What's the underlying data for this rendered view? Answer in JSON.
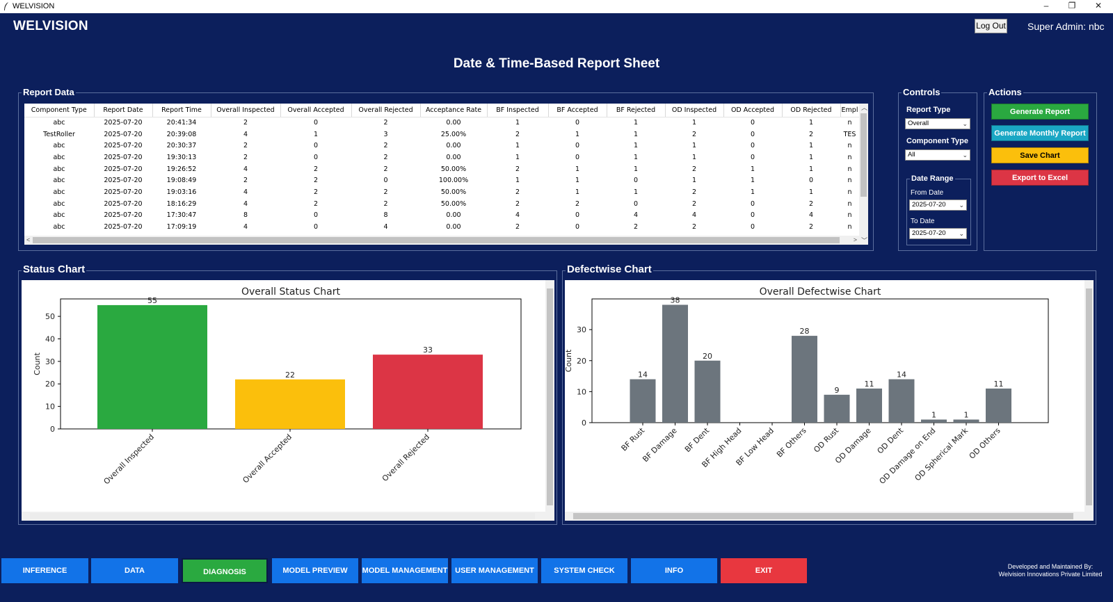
{
  "window": {
    "title": "WELVISION",
    "minimize": "–",
    "restore": "❐",
    "close": "✕"
  },
  "header": {
    "brand": "WELVISION",
    "logout_label": "Log Out",
    "user_label": "Super Admin: nbc"
  },
  "page_title": "Date & Time-Based Report Sheet",
  "report_data": {
    "label": "Report Data",
    "columns": [
      "Component Type",
      "Report Date",
      "Report Time",
      "Overall Inspected",
      "Overall Accepted",
      "Overall Rejected",
      "Acceptance Rate",
      "BF Inspected",
      "BF Accepted",
      "BF Rejected",
      "OD Inspected",
      "OD Accepted",
      "OD Rejected",
      "Empl"
    ],
    "rows": [
      [
        "abc",
        "2025-07-20",
        "20:41:34",
        "2",
        "0",
        "2",
        "0.00",
        "1",
        "0",
        "1",
        "1",
        "0",
        "1",
        "n"
      ],
      [
        "TestRoller",
        "2025-07-20",
        "20:39:08",
        "4",
        "1",
        "3",
        "25.00%",
        "2",
        "1",
        "1",
        "2",
        "0",
        "2",
        "TES"
      ],
      [
        "abc",
        "2025-07-20",
        "20:30:37",
        "2",
        "0",
        "2",
        "0.00",
        "1",
        "0",
        "1",
        "1",
        "0",
        "1",
        "n"
      ],
      [
        "abc",
        "2025-07-20",
        "19:30:13",
        "2",
        "0",
        "2",
        "0.00",
        "1",
        "0",
        "1",
        "1",
        "0",
        "1",
        "n"
      ],
      [
        "abc",
        "2025-07-20",
        "19:26:52",
        "4",
        "2",
        "2",
        "50.00%",
        "2",
        "1",
        "1",
        "2",
        "1",
        "1",
        "n"
      ],
      [
        "abc",
        "2025-07-20",
        "19:08:49",
        "2",
        "2",
        "0",
        "100.00%",
        "1",
        "1",
        "0",
        "1",
        "1",
        "0",
        "n"
      ],
      [
        "abc",
        "2025-07-20",
        "19:03:16",
        "4",
        "2",
        "2",
        "50.00%",
        "2",
        "1",
        "1",
        "2",
        "1",
        "1",
        "n"
      ],
      [
        "abc",
        "2025-07-20",
        "18:16:29",
        "4",
        "2",
        "2",
        "50.00%",
        "2",
        "2",
        "0",
        "2",
        "0",
        "2",
        "n"
      ],
      [
        "abc",
        "2025-07-20",
        "17:30:47",
        "8",
        "0",
        "8",
        "0.00",
        "4",
        "0",
        "4",
        "4",
        "0",
        "4",
        "n"
      ],
      [
        "abc",
        "2025-07-20",
        "17:09:19",
        "4",
        "0",
        "4",
        "0.00",
        "2",
        "0",
        "2",
        "2",
        "0",
        "2",
        "n"
      ]
    ]
  },
  "controls": {
    "label": "Controls",
    "report_type_label": "Report Type",
    "report_type_value": "Overall",
    "component_type_label": "Component Type",
    "component_type_value": "All",
    "date_range_label": "Date Range",
    "from_label": "From Date",
    "from_value": "2025-07-20",
    "to_label": "To Date",
    "to_value": "2025-07-20"
  },
  "actions": {
    "label": "Actions",
    "generate_report": "Generate Report",
    "generate_monthly": "Generate Monthly Report",
    "save_chart": "Save Chart",
    "export_excel": "Export to Excel"
  },
  "status_chart": {
    "section_label": "Status Chart"
  },
  "defect_chart": {
    "section_label": "Defectwise Chart"
  },
  "chart_data": [
    {
      "type": "bar",
      "title": "Overall Status Chart",
      "categories": [
        "Overall Inspected",
        "Overall Accepted",
        "Overall Rejected"
      ],
      "values": [
        55,
        22,
        33
      ],
      "colors": [
        "#2aa940",
        "#fbbf0c",
        "#dc3545"
      ],
      "ylabel": "Count",
      "ylim": [
        0,
        57.75
      ],
      "yticks": [
        0,
        10,
        20,
        30,
        40,
        50
      ],
      "grid": false
    },
    {
      "type": "bar",
      "title": "Overall Defectwise Chart",
      "categories": [
        "BF Rust",
        "BF Damage",
        "BF Dent",
        "BF High Head",
        "BF Low Head",
        "BF Others",
        "OD Rust",
        "OD Damage",
        "OD Dent",
        "OD Damage on End",
        "OD Spherical Mark",
        "OD Others"
      ],
      "values": [
        14,
        38,
        20,
        0,
        0,
        28,
        9,
        11,
        14,
        1,
        1,
        11
      ],
      "data_labels": [
        "14",
        "38",
        "20",
        "",
        "",
        "28",
        "9",
        "11",
        "14",
        "1",
        "1",
        "11"
      ],
      "colors": [
        "#6c757d"
      ],
      "ylabel": "Count",
      "ylim": [
        0,
        39.9
      ],
      "yticks": [
        0,
        10,
        20,
        30
      ],
      "grid": false
    }
  ],
  "nav": [
    {
      "label": "INFERENCE",
      "color": "#1273e8"
    },
    {
      "label": "DATA",
      "color": "#1273e8"
    },
    {
      "label": "DIAGNOSIS",
      "color": "#2aa940"
    },
    {
      "label": "MODEL PREVIEW",
      "color": "#1273e8"
    },
    {
      "label": "MODEL MANAGEMENT",
      "color": "#1273e8"
    },
    {
      "label": "USER MANAGEMENT",
      "color": "#1273e8"
    },
    {
      "label": "SYSTEM CHECK",
      "color": "#1273e8"
    },
    {
      "label": "INFO",
      "color": "#1273e8"
    },
    {
      "label": "EXIT",
      "color": "#e8373f"
    }
  ],
  "footer": {
    "line1": "Developed and Maintained By:",
    "line2": "Welvision Innovations Private Limited"
  }
}
